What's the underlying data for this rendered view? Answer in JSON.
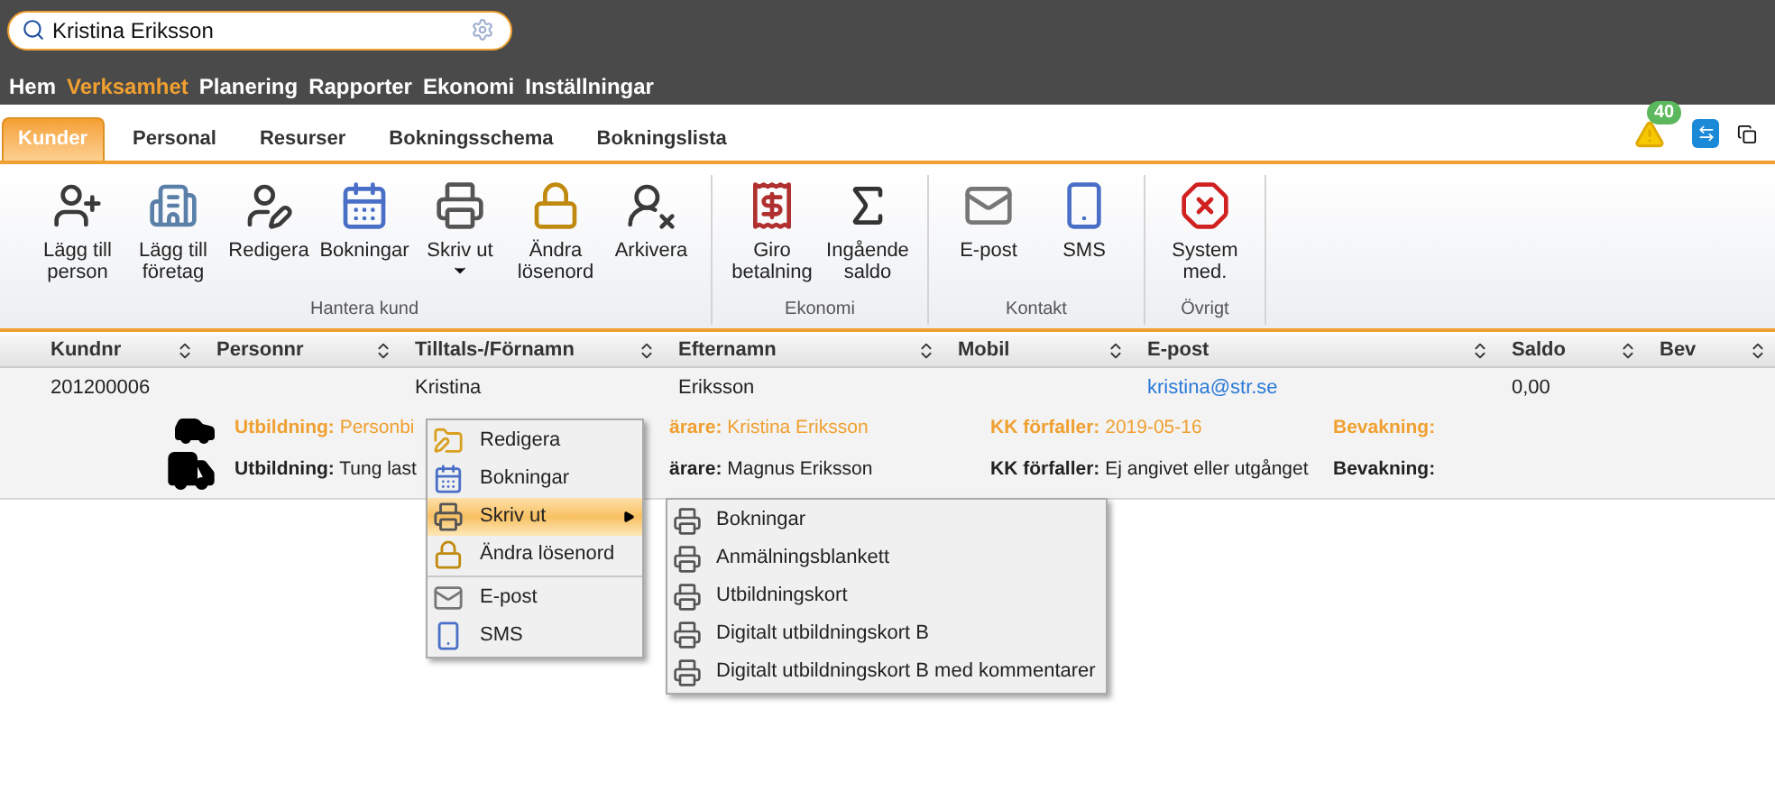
{
  "search": {
    "value": "Kristina Eriksson"
  },
  "nav": [
    {
      "label": "Hem",
      "selected": false
    },
    {
      "label": "Verksamhet",
      "selected": true
    },
    {
      "label": "Planering",
      "selected": false
    },
    {
      "label": "Rapporter",
      "selected": false
    },
    {
      "label": "Ekonomi",
      "selected": false
    },
    {
      "label": "Inställningar",
      "selected": false
    }
  ],
  "tabs": [
    {
      "label": "Kunder",
      "selected": true
    },
    {
      "label": "Personal",
      "selected": false
    },
    {
      "label": "Resurser",
      "selected": false
    },
    {
      "label": "Bokningsschema",
      "selected": false
    },
    {
      "label": "Bokningslista",
      "selected": false
    }
  ],
  "alerts": {
    "count": "40"
  },
  "ribbon": [
    {
      "label": "Hantera kund",
      "buttons": [
        {
          "label": "Lägg till person",
          "dropdown": false
        },
        {
          "label": "Lägg till företag",
          "dropdown": false
        },
        {
          "label": "Redigera",
          "dropdown": false
        },
        {
          "label": "Bokningar",
          "dropdown": false
        },
        {
          "label": "Skriv ut",
          "dropdown": true
        },
        {
          "label": "Ändra lösenord",
          "dropdown": false
        },
        {
          "label": "Arkivera",
          "dropdown": false
        }
      ]
    },
    {
      "label": "Ekonomi",
      "buttons": [
        {
          "label": "Giro betalning",
          "dropdown": false
        },
        {
          "label": "Ingående saldo",
          "dropdown": false
        }
      ]
    },
    {
      "label": "Kontakt",
      "buttons": [
        {
          "label": "E-post",
          "dropdown": false
        },
        {
          "label": "SMS",
          "dropdown": false
        }
      ]
    },
    {
      "label": "Övrigt",
      "buttons": [
        {
          "label": "System med.",
          "dropdown": false
        }
      ]
    }
  ],
  "table": {
    "columns": [
      "Kundnr",
      "Personnr",
      "Tilltals-/Förnamn",
      "Efternamn",
      "Mobil",
      "E-post",
      "Saldo",
      "Bev"
    ],
    "rows": [
      {
        "kundnr": "201200006",
        "fornamn": "Kristina",
        "efternamn": "Eriksson",
        "epost": "kristina@str.se",
        "saldo": "0,00",
        "details": [
          {
            "highlighted": true,
            "fields": [
              {
                "label": "Utbildning:",
                "value": "Personbi"
              },
              {
                "label": "ärare:",
                "value": "Kristina Eriksson"
              },
              {
                "label": "KK förfaller:",
                "value": "2019-05-16"
              },
              {
                "label": "Bevakning:"
              }
            ]
          },
          {
            "highlighted": false,
            "fields": [
              {
                "label": "Utbildning:",
                "value": "Tung last"
              },
              {
                "label": "ärare:",
                "value": "Magnus Eriksson"
              },
              {
                "label": "KK förfaller:",
                "value": "Ej angivet eller utgånget"
              },
              {
                "label": "Bevakning:"
              }
            ]
          }
        ]
      }
    ]
  },
  "context_menu": {
    "items": [
      {
        "label": "Redigera",
        "selected": false,
        "submenu": false,
        "separator_before": false
      },
      {
        "label": "Bokningar",
        "selected": false,
        "submenu": false,
        "separator_before": false
      },
      {
        "label": "Skriv ut",
        "selected": true,
        "submenu": true,
        "separator_before": false
      },
      {
        "label": "Ändra lösenord",
        "selected": false,
        "submenu": false,
        "separator_before": false
      },
      {
        "label": "E-post",
        "selected": false,
        "submenu": false,
        "separator_before": true
      },
      {
        "label": "SMS",
        "selected": false,
        "submenu": false,
        "separator_before": false
      }
    ],
    "submenu": [
      {
        "label": "Bokningar"
      },
      {
        "label": "Anmälningsblankett"
      },
      {
        "label": "Utbildningskort"
      },
      {
        "label": "Digitalt utbildningskort B"
      },
      {
        "label": "Digitalt utbildningskort B med kommentarer"
      }
    ]
  }
}
